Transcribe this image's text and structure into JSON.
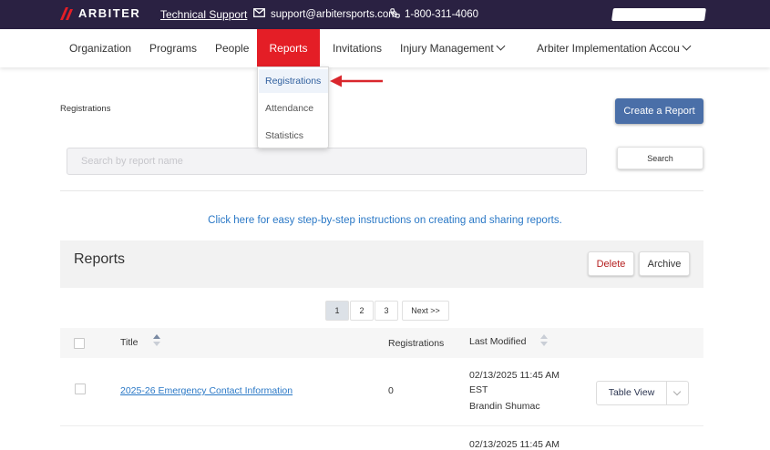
{
  "topbar": {
    "logo_text": "ARBITER",
    "support_label": "Technical Support",
    "email": "support@arbitersports.com",
    "phone": "1-800-311-4060"
  },
  "nav": {
    "items": [
      {
        "label": "Organization"
      },
      {
        "label": "Programs"
      },
      {
        "label": "People"
      },
      {
        "label": "Reports"
      },
      {
        "label": "Invitations"
      },
      {
        "label": "Injury Management"
      },
      {
        "label": "Arbiter Implementation Accou"
      }
    ],
    "active": "Reports"
  },
  "reports_menu": {
    "items": [
      {
        "label": "Registrations"
      },
      {
        "label": "Attendance"
      },
      {
        "label": "Statistics"
      }
    ]
  },
  "page": {
    "breadcrumb": "Registrations",
    "create_button": "Create a Report",
    "search_placeholder": "Search by report name",
    "search_button": "Search",
    "help_link": "Click here for easy step-by-step instructions on creating and sharing reports."
  },
  "panel": {
    "title": "Reports",
    "delete_label": "Delete",
    "archive_label": "Archive",
    "pages": [
      "1",
      "2",
      "3"
    ],
    "next_label": "Next >>",
    "columns": {
      "title": "Title",
      "registrations": "Registrations",
      "last_modified": "Last Modified"
    },
    "rows": [
      {
        "title": "2025-26 Emergency Contact Information",
        "registrations": "0",
        "modified_date": "02/13/2025 11:45 AM",
        "modified_tz": "EST",
        "modified_by": "Brandin Shumac",
        "action": "Table View"
      },
      {
        "modified_date": "02/13/2025 11:45 AM"
      }
    ]
  },
  "colors": {
    "topbar": "#2a2142",
    "accent_red": "#e41e26",
    "button_blue": "#4a6fa8",
    "link_blue": "#2a78c6"
  }
}
